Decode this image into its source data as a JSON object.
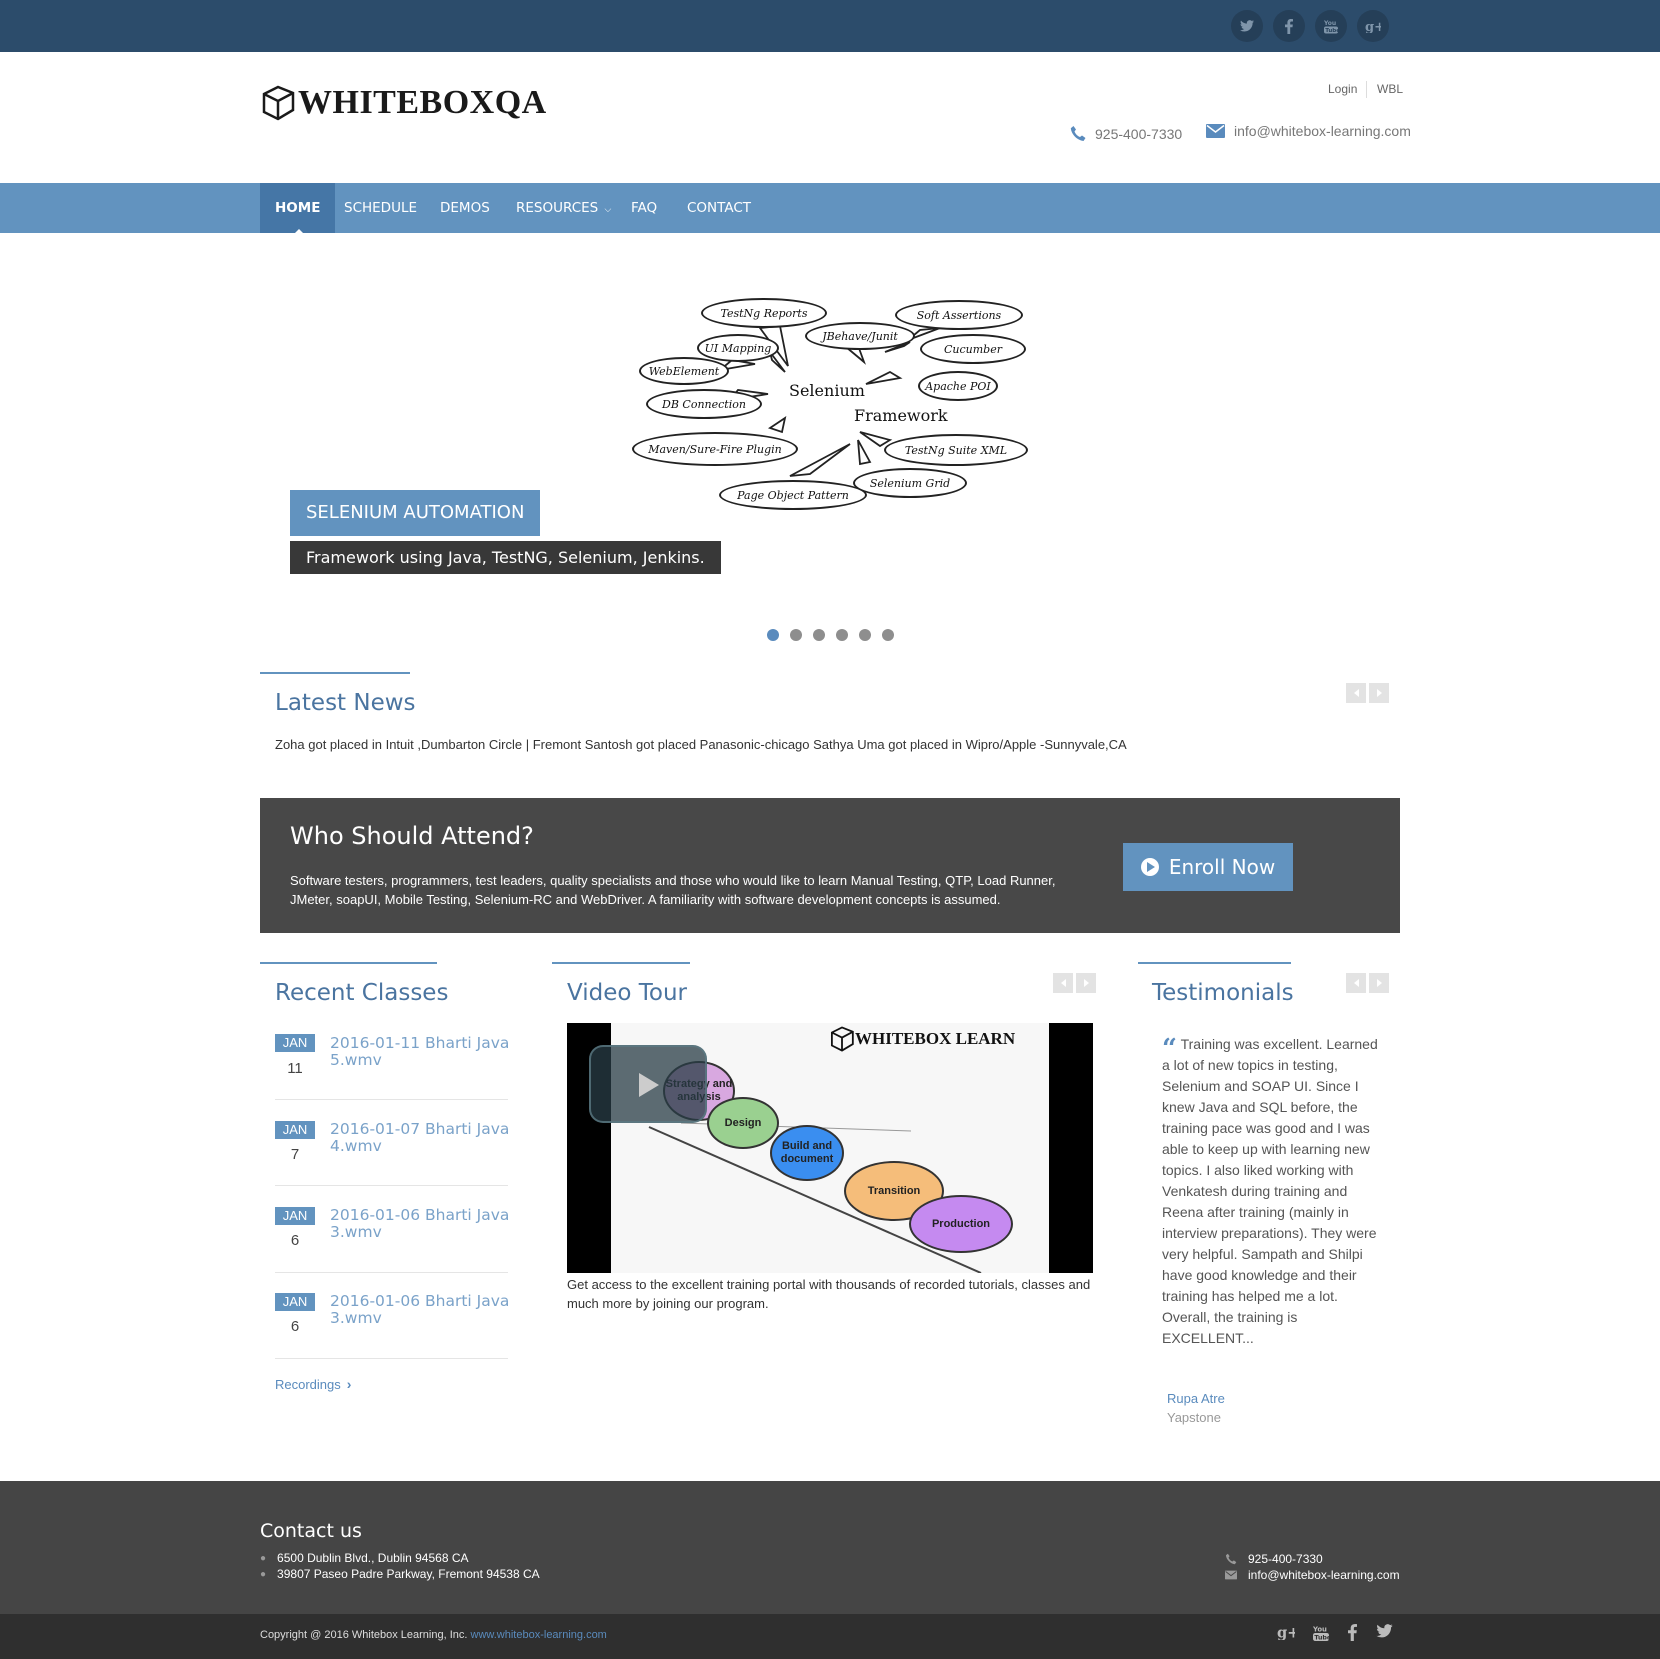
{
  "topbar": {
    "social": [
      "twitter-icon",
      "facebook-icon",
      "youtube-icon",
      "google-plus-icon"
    ]
  },
  "header": {
    "logo_text": "WHITEBOXQA",
    "login": "Login",
    "wbl": "WBL",
    "phone": "925-400-7330",
    "email": "info@whitebox-learning.com"
  },
  "nav": {
    "items": [
      {
        "label": "HOME"
      },
      {
        "label": "SCHEDULE"
      },
      {
        "label": "DEMOS"
      },
      {
        "label": "RESOURCES"
      },
      {
        "label": "FAQ"
      },
      {
        "label": "CONTACT"
      }
    ],
    "active": "HOME"
  },
  "slider": {
    "bubbles": [
      "TestNg Reports",
      "Soft Assertions",
      "JBehave/Junit",
      "UI Mapping",
      "Cucumber",
      "WebElement",
      "Apache POI",
      "DB Connection",
      "Maven/Sure-Fire Plugin",
      "TestNg Suite XML",
      "Page Object Pattern",
      "Selenium Grid"
    ],
    "center_word1": "Selenium",
    "center_word2": "Framework",
    "title": "SELENIUM AUTOMATION",
    "subtitle": "Framework using Java, TestNG, Selenium, Jenkins.",
    "dot_count": 6,
    "active_dot": 1
  },
  "news": {
    "title": "Latest News",
    "text": "Zoha got placed in Intuit ,Dumbarton Circle | Fremont Santosh got placed Panasonic-chicago Sathya Uma got placed in Wipro/Apple -Sunnyvale,CA"
  },
  "attend": {
    "title": "Who Should Attend?",
    "text": "Software testers, programmers, test leaders, quality specialists and those who would like to learn Manual Testing, QTP, Load Runner, JMeter, soapUI, Mobile Testing, Selenium-RC and WebDriver. A familiarity with software development concepts is assumed.",
    "button": "Enroll Now"
  },
  "recent_classes": {
    "title": "Recent Classes",
    "items": [
      {
        "month": "JAN",
        "day": "11",
        "title": "2016-01-11 Bharti Java 5.wmv"
      },
      {
        "month": "JAN",
        "day": "7",
        "title": "2016-01-07 Bharti Java 4.wmv"
      },
      {
        "month": "JAN",
        "day": "6",
        "title": "2016-01-06 Bharti Java 3.wmv"
      },
      {
        "month": "JAN",
        "day": "6",
        "title": "2016-01-06 Bharti Java 3.wmv"
      }
    ],
    "link": "Recordings"
  },
  "video": {
    "title": "Video Tour",
    "watermark": "WHITEBOX LEARN",
    "stages": [
      "Strategy and analysis",
      "Design",
      "Build and document",
      "Transition",
      "Production"
    ],
    "caption": "Get access to the excellent training portal with thousands of recorded tutorials, classes and much more by joining our program."
  },
  "testimonials": {
    "title": "Testimonials",
    "quote": "Training was excellent. Learned a lot of new topics in testing, Selenium and SOAP UI. Since I knew Java and SQL before, the training pace was good and I was able to keep up with learning new topics. I also liked working with Venkatesh during training and Reena after training (mainly in interview preparations). They were very helpful. Sampath and Shilpi have good knowledge and their training has helped me a lot. Overall, the training is EXCELLENT...",
    "author": "Rupa Atre",
    "company": "Yapstone"
  },
  "footer": {
    "title": "Contact us",
    "address1": "6500 Dublin Blvd., Dublin 94568 CA",
    "address2": "39807 Paseo Padre Parkway, Fremont 94538 CA",
    "phone": "925-400-7330",
    "email": "info@whitebox-learning.com",
    "copyright": "Copyright @ 2016 Whitebox Learning, Inc.",
    "site": "www.whitebox-learning.com",
    "social": [
      "google-plus-icon",
      "youtube-icon",
      "facebook-icon",
      "twitter-icon"
    ]
  },
  "colors": {
    "topbar": "#2c4c6b",
    "nav": "#6293bf",
    "nav_active": "#4576a6",
    "dark_band": "#484848",
    "footer": "#454545",
    "copyright_bar": "#2f2f2f"
  }
}
